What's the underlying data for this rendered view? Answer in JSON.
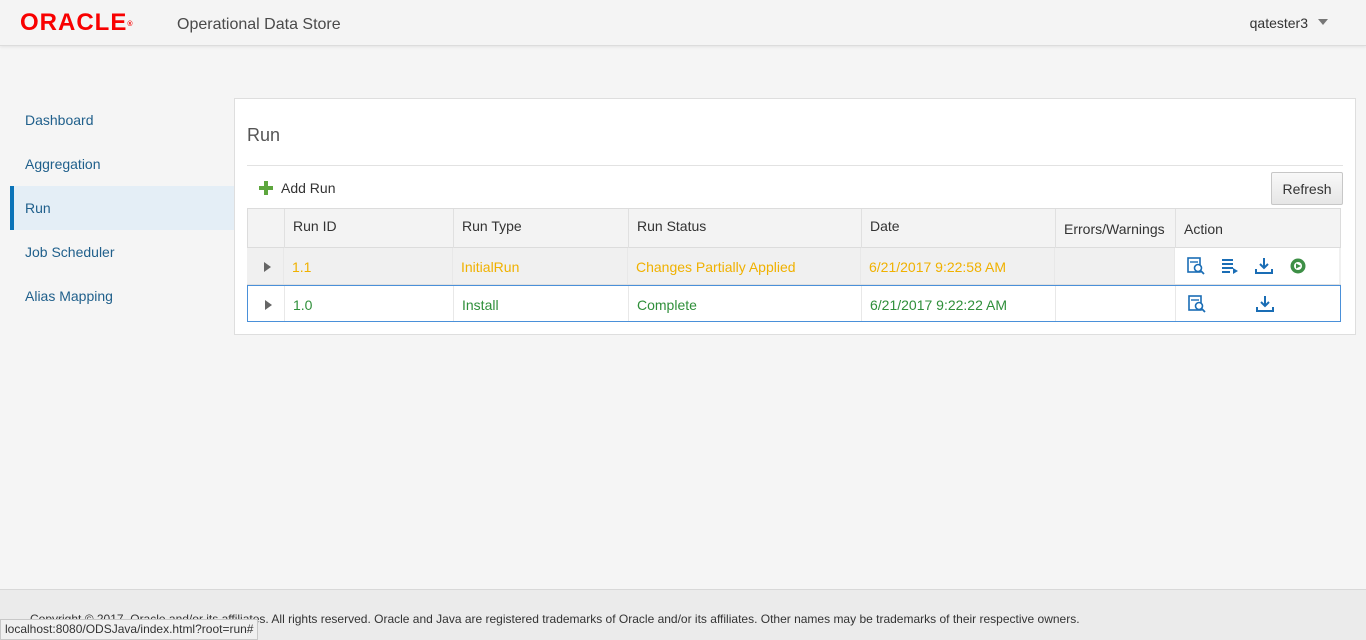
{
  "header": {
    "logo_text": "ORACLE",
    "logo_mark": "®",
    "app_title": "Operational Data Store",
    "user": "qatester3",
    "user_menu_icon": "caret-down-icon"
  },
  "nav": {
    "items": [
      {
        "label": "Dashboard"
      },
      {
        "label": "Aggregation"
      },
      {
        "label": "Run",
        "active": true
      },
      {
        "label": "Job Scheduler"
      },
      {
        "label": "Alias Mapping"
      }
    ]
  },
  "panel": {
    "title": "Run",
    "add_label": "Add Run",
    "refresh_label": "Refresh"
  },
  "table": {
    "columns": [
      "Run ID",
      "Run Type",
      "Run Status",
      "Date",
      "Errors/Warnings",
      "Action"
    ],
    "rows": [
      {
        "run_id": "1.1",
        "run_type": "InitialRun",
        "run_status": "Changes Partially Applied",
        "date": "6/21/2017 9:22:58 AM",
        "errors": "",
        "actions": [
          "view-details-icon",
          "view-log-icon",
          "download-icon",
          "resume-icon"
        ]
      },
      {
        "run_id": "1.0",
        "run_type": "Install",
        "run_status": "Complete",
        "date": "6/21/2017 9:22:22 AM",
        "errors": "",
        "actions": [
          "view-details-icon",
          "download-icon"
        ]
      }
    ]
  },
  "colors": {
    "brand": "#f80000",
    "partial_status": "#f0b100",
    "complete_status": "#2f8f3a",
    "link": "#1f5f8b",
    "action_icon": "#1a6db5"
  },
  "footer": {
    "copyright": "Copyright © 2017, Oracle and/or its affiliates. All rights reserved. Oracle and Java are registered trademarks of Oracle and/or its affiliates. Other names may be trademarks of their respective owners."
  },
  "statusbar": {
    "url": "localhost:8080/ODSJava/index.html?root=run#"
  }
}
